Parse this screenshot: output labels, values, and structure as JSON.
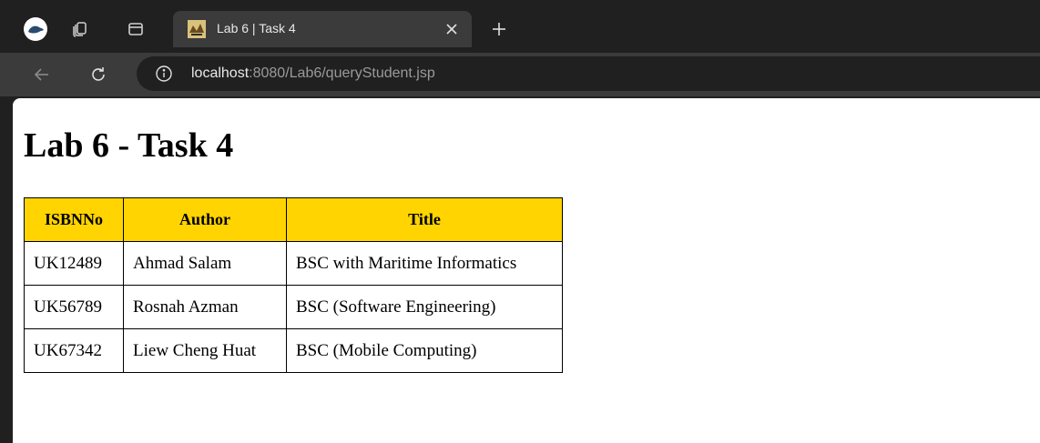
{
  "tab": {
    "title": "Lab 6 | Task 4"
  },
  "address": {
    "host": "localhost",
    "path": ":8080/Lab6/queryStudent.jsp"
  },
  "page": {
    "heading": "Lab 6 - Task 4"
  },
  "table": {
    "headers": [
      "ISBNNo",
      "Author",
      "Title"
    ],
    "rows": [
      [
        "UK12489",
        "Ahmad Salam",
        "BSC with Maritime Informatics"
      ],
      [
        "UK56789",
        "Rosnah Azman",
        "BSC (Software Engineering)"
      ],
      [
        "UK67342",
        "Liew Cheng Huat",
        "BSC (Mobile Computing)"
      ]
    ]
  },
  "icons": {
    "profile": "profile-avatar-icon",
    "workspaces": "workspaces-icon",
    "tab_actions": "tab-actions-icon",
    "favicon": "tomcat-favicon-icon",
    "close": "close-icon",
    "new_tab": "plus-icon",
    "back": "back-arrow-icon",
    "refresh": "refresh-icon",
    "site_info": "info-icon"
  },
  "colors": {
    "header_fill": "#ffd400",
    "chrome_dark": "#202020",
    "chrome_mid": "#3b3b3b"
  }
}
